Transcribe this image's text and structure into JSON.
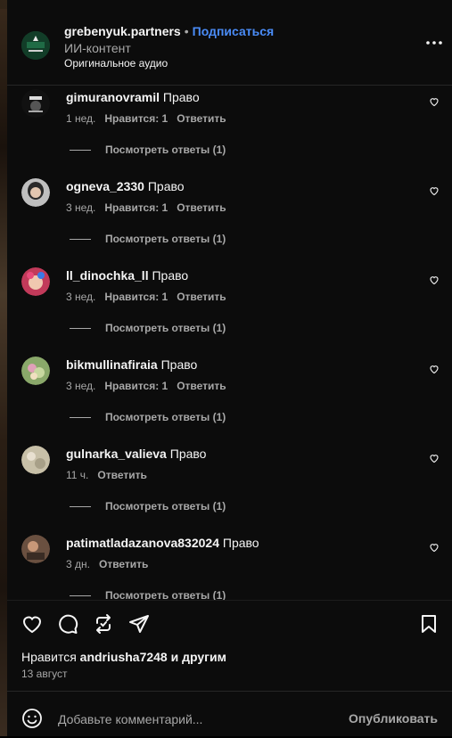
{
  "header": {
    "username": "grebenyuk.partners",
    "separator": "•",
    "follow_label": "Подписаться",
    "subtitle": "ИИ-контент",
    "audio": "Оригинальное аудио",
    "more_icon": "more-horizontal-icon"
  },
  "comments": [
    {
      "user": "gimuranovramil",
      "text": "Право",
      "time": "1 нед.",
      "likes": "Нравится: 1",
      "reply": "Ответить",
      "view_replies": "Посмотреть ответы (1)"
    },
    {
      "user": "ogneva_2330",
      "text": "Право",
      "time": "3 нед.",
      "likes": "Нравится: 1",
      "reply": "Ответить",
      "view_replies": "Посмотреть ответы (1)"
    },
    {
      "user": "ll_dinochka_ll",
      "text": "Право",
      "time": "3 нед.",
      "likes": "Нравится: 1",
      "reply": "Ответить",
      "view_replies": "Посмотреть ответы (1)"
    },
    {
      "user": "bikmullinafiraia",
      "text": "Право",
      "time": "3 нед.",
      "likes": "Нравится: 1",
      "reply": "Ответить",
      "view_replies": "Посмотреть ответы (1)"
    },
    {
      "user": "gulnarka_valieva",
      "text": "Право",
      "time": "11 ч.",
      "likes": "",
      "reply": "Ответить",
      "view_replies": "Посмотреть ответы (1)"
    },
    {
      "user": "patimatladazanova832024",
      "text": "Право",
      "time": "3 дн.",
      "likes": "",
      "reply": "Ответить",
      "view_replies": "Посмотреть ответы (1)"
    }
  ],
  "actions": {
    "likes_prefix": "Нравится",
    "likes_user": "andriusha7248",
    "likes_suffix": "и другим",
    "date": "13 август"
  },
  "comment_box": {
    "placeholder": "Добавьте комментарий...",
    "publish_label": "Опубликовать"
  },
  "colors": {
    "accent": "#4a8cf7",
    "muted": "#a8a8a8",
    "background": "#0c0c0c"
  }
}
